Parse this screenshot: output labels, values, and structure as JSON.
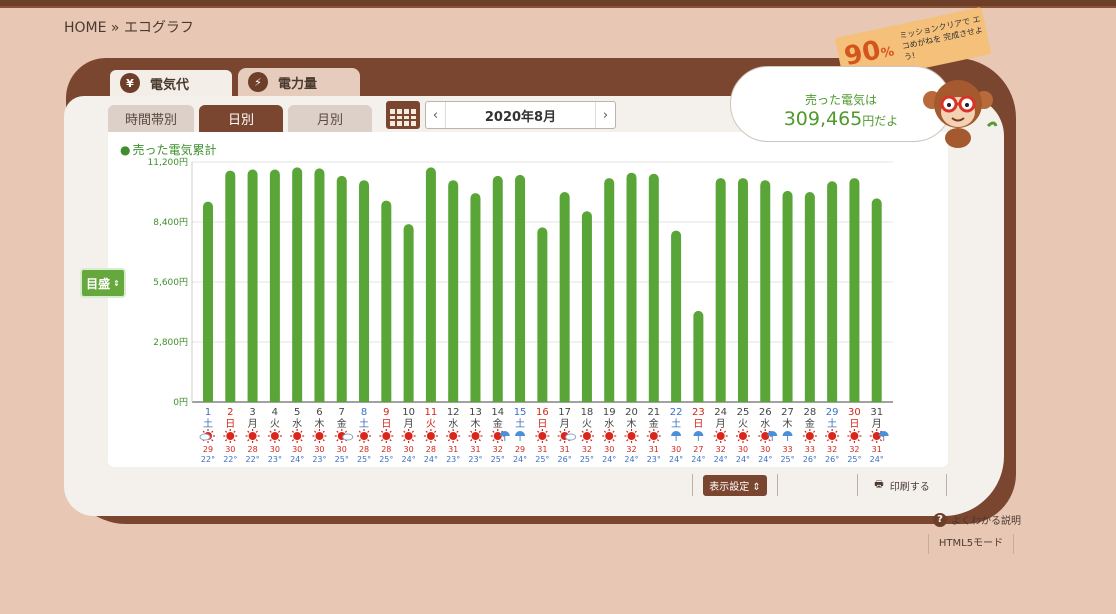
{
  "breadcrumb": "HOME » エコグラフ",
  "tabs": {
    "main": [
      {
        "label": "電気代",
        "icon": "yen-icon",
        "active": true
      },
      {
        "label": "電力量",
        "icon": "lightning-icon",
        "active": false
      }
    ],
    "sub": [
      {
        "label": "時間帯別",
        "active": false
      },
      {
        "label": "日別",
        "active": true
      },
      {
        "label": "月別",
        "active": false
      }
    ]
  },
  "date_nav": {
    "label": "2020年8月",
    "prev": "‹",
    "next": "›"
  },
  "legend": "売った電気累計",
  "scale_button": "目盛",
  "mission_tag": {
    "percent": "90",
    "unit": "%",
    "message": "ミッションクリアで エコめがねを 完成させよう!"
  },
  "bubble": {
    "line1": "売った電気は",
    "amount": "309,465",
    "suffix": "円だよ"
  },
  "toolbar": {
    "display_settings": "表示設定",
    "print": "印刷する"
  },
  "help_link": "よくわかる説明",
  "html5_link": "HTML5モード",
  "colors": {
    "bar": "#5aa537",
    "weekend_blue": "#3a6fc4",
    "holiday_red": "#d0261c",
    "brown": "#7a4630"
  },
  "chart_data": {
    "type": "bar",
    "title": "",
    "legend": "売った電気累計",
    "ylim": [
      0,
      11200
    ],
    "yticks": [
      "0円",
      "2,800円",
      "5,600円",
      "8,400円",
      "11,200円"
    ],
    "categories": [
      "1",
      "2",
      "3",
      "4",
      "5",
      "6",
      "7",
      "8",
      "9",
      "10",
      "11",
      "12",
      "13",
      "14",
      "15",
      "16",
      "17",
      "18",
      "19",
      "20",
      "21",
      "22",
      "23",
      "24",
      "25",
      "26",
      "27",
      "28",
      "29",
      "30",
      "31"
    ],
    "weekdays": [
      "土",
      "日",
      "月",
      "火",
      "水",
      "木",
      "金",
      "土",
      "日",
      "月",
      "火",
      "水",
      "木",
      "金",
      "土",
      "日",
      "月",
      "火",
      "水",
      "木",
      "金",
      "土",
      "日",
      "月",
      "火",
      "水",
      "木",
      "金",
      "土",
      "日",
      "月"
    ],
    "day_colors": [
      "blue",
      "red",
      "normal",
      "normal",
      "normal",
      "normal",
      "normal",
      "blue",
      "red",
      "normal",
      "red",
      "normal",
      "normal",
      "normal",
      "blue",
      "red",
      "normal",
      "normal",
      "normal",
      "normal",
      "normal",
      "blue",
      "red",
      "normal",
      "normal",
      "normal",
      "normal",
      "normal",
      "blue",
      "red",
      "normal"
    ],
    "values": [
      9350,
      10800,
      10850,
      10850,
      10950,
      10900,
      10550,
      10350,
      9400,
      8300,
      10950,
      10350,
      9750,
      10550,
      10600,
      8150,
      9800,
      8900,
      10450,
      10700,
      10650,
      8000,
      4250,
      10450,
      10450,
      10350,
      9850,
      9800,
      10300,
      10450,
      9500
    ],
    "weather": [
      "cloud-sun",
      "sun",
      "sun",
      "sun",
      "sun",
      "sun",
      "sun-cloud",
      "sun",
      "sun",
      "sun",
      "sun",
      "sun",
      "sun",
      "sun-rain",
      "rain",
      "sun",
      "sun-cloud",
      "sun",
      "sun",
      "sun",
      "sun",
      "rain",
      "rain",
      "sun",
      "sun",
      "sun-rain",
      "rain",
      "sun",
      "sun",
      "sun",
      "sun-rain"
    ],
    "temp_high": [
      29,
      30,
      28,
      30,
      30,
      30,
      30,
      28,
      28,
      30,
      28,
      31,
      31,
      32,
      29,
      31,
      31,
      32,
      30,
      32,
      31,
      30,
      27,
      32,
      30,
      30,
      33,
      33,
      32,
      32,
      31
    ],
    "temp_low": [
      22,
      22,
      22,
      23,
      24,
      23,
      25,
      25,
      25,
      24,
      24,
      23,
      23,
      25,
      24,
      25,
      26,
      25,
      24,
      24,
      23,
      24,
      24,
      24,
      24,
      24,
      25,
      26,
      26,
      25,
      24
    ]
  }
}
